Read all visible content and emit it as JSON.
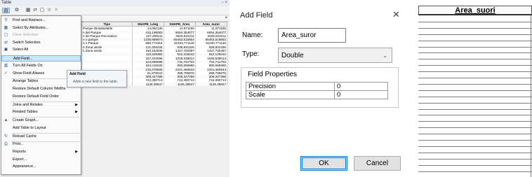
{
  "table_window": {
    "title": "Table",
    "title_buttons": "− ×",
    "table_tab_close": "×",
    "toolbar_icons": [
      "table-options-icon",
      "related-tables-icon",
      "select-by-attributes-icon",
      "switch-selection-icon",
      "clear-selection-icon",
      "zoom-to-selected-icon",
      "delete-selected-icon"
    ],
    "columns": [
      "Tipo",
      "SHAPE_Leng",
      "SHAPE_Area",
      "Area_suror"
    ],
    "rows": [
      [
        "Parque Biosaludable",
        "14,062136",
        "11,971169",
        "11,971169"
      ],
      [
        "n del Parque",
        "415,199083",
        "6064,354077",
        "6064,354077"
      ],
      [
        "n de Parque Recreativo",
        "227,258111",
        "2625,623211",
        "2625,623211"
      ],
      [
        "n o parque",
        "1236,969874",
        "65463,516654",
        "65463,516654"
      ],
      [
        "n o Parque",
        "686,771916",
        "31033,771146",
        "31033,771146"
      ],
      [
        "n Zona verde",
        "121,303234",
        "636,931325",
        "636,931325"
      ],
      [
        "n Zona verde",
        "160,152936",
        "1447,700397",
        "1447,700397"
      ],
      [
        "",
        "118,329384",
        "812,126242",
        "812,126242"
      ],
      [
        "",
        "157,202596",
        "1028,539014",
        "1028,539014"
      ],
      [
        "",
        "124,695568",
        "731,741702",
        "731,741702"
      ],
      [
        "",
        "154,415525",
        "890,665965",
        "890,665965"
      ],
      [
        "",
        "215,378628",
        "2441,460544",
        "2441,460544"
      ],
      [
        "arque",
        "81,978044",
        "399,796876",
        "399,796876"
      ],
      [
        "arque o Zona verde",
        "308,327298",
        "308,327298",
        "308,327298"
      ],
      [
        "arque o Zona verde",
        "742,390713",
        "742,390713",
        "742,390713"
      ],
      [
        "la el Adulto Mayor",
        "1125,38647",
        "1125,38647",
        "1125,38647"
      ]
    ]
  },
  "menu": {
    "items": [
      {
        "label": "Find and Replace...",
        "icon": "binoculars-icon",
        "disabled": false,
        "submenu": false
      },
      {
        "label": "Select By Attributes...",
        "icon": "select-by-attributes-icon",
        "disabled": false,
        "submenu": false
      },
      {
        "label": "Clear Selection",
        "icon": "clear-selection-icon",
        "disabled": true,
        "submenu": false
      },
      {
        "label": "Switch Selection",
        "icon": "switch-selection-icon",
        "disabled": false,
        "submenu": false
      },
      {
        "label": "Select All",
        "icon": "select-all-icon",
        "disabled": false,
        "submenu": false
      },
      {
        "label": "Add Field...",
        "icon": "",
        "disabled": false,
        "submenu": false,
        "active": true
      },
      {
        "label": "Turn All Fields On",
        "icon": "fields-on-icon",
        "disabled": false,
        "submenu": false
      },
      {
        "label": "Show Field Aliases",
        "icon": "checkmark-icon",
        "disabled": false,
        "submenu": false
      },
      {
        "label": "Arrange Tables",
        "icon": "",
        "disabled": false,
        "submenu": true
      },
      {
        "label": "Restore Default Column Widths",
        "icon": "",
        "disabled": false,
        "submenu": false
      },
      {
        "label": "Restore Default Field Order",
        "icon": "",
        "disabled": false,
        "submenu": false
      },
      {
        "label": "Joins and Relates",
        "icon": "",
        "disabled": false,
        "submenu": true
      },
      {
        "label": "Related Tables",
        "icon": "",
        "disabled": false,
        "submenu": true
      },
      {
        "label": "Create Graph...",
        "icon": "graph-icon",
        "disabled": false,
        "submenu": false
      },
      {
        "label": "Add Table to Layout",
        "icon": "",
        "disabled": false,
        "submenu": false
      },
      {
        "label": "Reload Cache",
        "icon": "reload-icon",
        "disabled": false,
        "submenu": false
      },
      {
        "label": "Print...",
        "icon": "print-icon",
        "disabled": false,
        "submenu": false
      },
      {
        "label": "Reports",
        "icon": "",
        "disabled": false,
        "submenu": true
      },
      {
        "label": "Export...",
        "icon": "",
        "disabled": false,
        "submenu": false
      },
      {
        "label": "Appearance...",
        "icon": "",
        "disabled": false,
        "submenu": false
      }
    ],
    "tooltip_title": "Add Field",
    "tooltip_desc": "Adds a new field to the table."
  },
  "add_field_dialog": {
    "title": "Add Field",
    "close_glyph": "✕",
    "name_label": "Name:",
    "name_value": "Area_suror",
    "type_label": "Type:",
    "type_value": "Double",
    "field_properties_label": "Field Properties",
    "properties": [
      {
        "name": "Precision",
        "value": "0"
      },
      {
        "name": "Scale",
        "value": "0"
      }
    ],
    "ok_label": "OK",
    "cancel_label": "Cancel"
  },
  "column_view": {
    "header": "Area_suori",
    "empty_rows": 26
  },
  "colors": {
    "menu_highlight": "#cce4f7",
    "accent": "#0078d7"
  }
}
